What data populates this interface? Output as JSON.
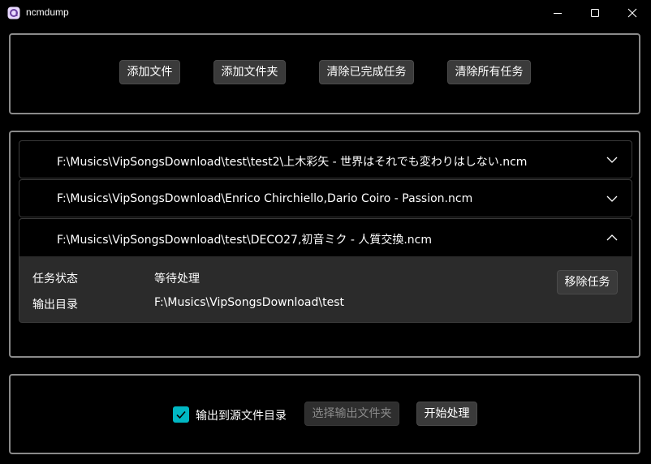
{
  "window": {
    "title": "ncmdump",
    "icon": "app-logo-icon",
    "controls": [
      "minimize-icon",
      "maximize-icon",
      "close-icon"
    ]
  },
  "toolbar": {
    "add_file": "添加文件",
    "add_folder": "添加文件夹",
    "clear_completed": "清除已完成任务",
    "clear_all": "清除所有任务"
  },
  "tasks": [
    {
      "path": "F:\\Musics\\VipSongsDownload\\test\\test2\\上木彩矢 - 世界はそれでも変わりはしない.ncm",
      "expanded": false
    },
    {
      "path": "F:\\Musics\\VipSongsDownload\\Enrico Chirchiello,Dario Coiro - Passion.ncm",
      "expanded": false
    },
    {
      "path": "F:\\Musics\\VipSongsDownload\\test\\DECO27,初音ミク - 人質交換.ncm",
      "expanded": true
    }
  ],
  "detail": {
    "status_label": "任务状态",
    "status_value": "等待处理",
    "output_label": "输出目录",
    "output_value": "F:\\Musics\\VipSongsDownload\\test",
    "remove_button": "移除任务"
  },
  "footer": {
    "output_to_source_label": "输出到源文件目录",
    "output_to_source_checked": true,
    "select_output_folder": "选择输出文件夹",
    "start_processing": "开始处理"
  },
  "colors": {
    "accent": "#00b7c3",
    "panel_border": "#8a8a8a",
    "button_bg": "#3a3a3a"
  }
}
